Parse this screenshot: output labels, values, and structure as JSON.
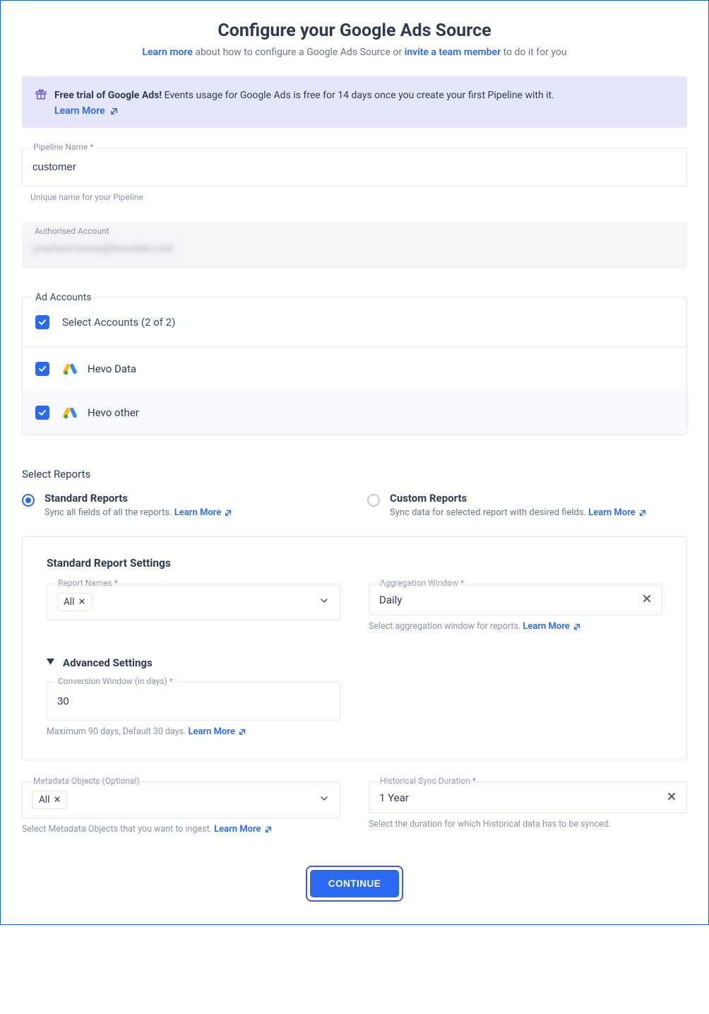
{
  "header": {
    "title": "Configure your Google Ads Source",
    "learn_link": "Learn more",
    "subtitle_mid": " about how to configure a Google Ads Source or ",
    "invite_link": "invite a team member",
    "subtitle_end": " to do it for you"
  },
  "banner": {
    "title": "Free trial of Google Ads!",
    "text": "  Events usage for Google Ads is free for 14 days once you create your first Pipeline with it.",
    "learn": "Learn More"
  },
  "pipeline": {
    "label": "Pipeline Name *",
    "value": "customer",
    "helper": "Unique name for your Pipeline"
  },
  "auth": {
    "label": "Authorised Account",
    "value": "prashant.kumar@hevodata.com"
  },
  "adAccounts": {
    "legend": "Ad Accounts",
    "select_label": "Select Accounts (2 of 2)",
    "items": [
      {
        "name": "Hevo Data"
      },
      {
        "name": "Hevo  other"
      }
    ]
  },
  "reports": {
    "heading": "Select Reports",
    "standard": {
      "title": "Standard Reports",
      "desc_prefix": "Sync all fields of all the reports. ",
      "learn": "Learn More"
    },
    "custom": {
      "title": "Custom Reports",
      "desc_prefix": "Sync data for selected report with desired fields. ",
      "learn": "Learn More"
    }
  },
  "settingsCard": {
    "title": "Standard Report Settings",
    "reportNames": {
      "label": "Report Names *",
      "chip": "All"
    },
    "aggWindow": {
      "label": "Aggregation Window *",
      "value": "Daily",
      "helper_prefix": "Select aggregation window for reports. ",
      "learn": "Learn More"
    },
    "advanced": {
      "title": "Advanced Settings",
      "conv": {
        "label": "Conversion Window (in days) *",
        "value": "30",
        "helper_prefix": "Maximum 90 days, Default 30 days. ",
        "learn": "Learn More"
      }
    }
  },
  "meta": {
    "label": "Metadata Objects (Optional)",
    "chip": "All",
    "helper_prefix": "Select Metadata Objects that you want to ingest. ",
    "learn": "Learn More"
  },
  "hist": {
    "label": "Historical Sync Duration *",
    "value": "1 Year",
    "helper": "Select the duration for which Historical data has to be synced."
  },
  "actions": {
    "continue": "CONTINUE"
  }
}
